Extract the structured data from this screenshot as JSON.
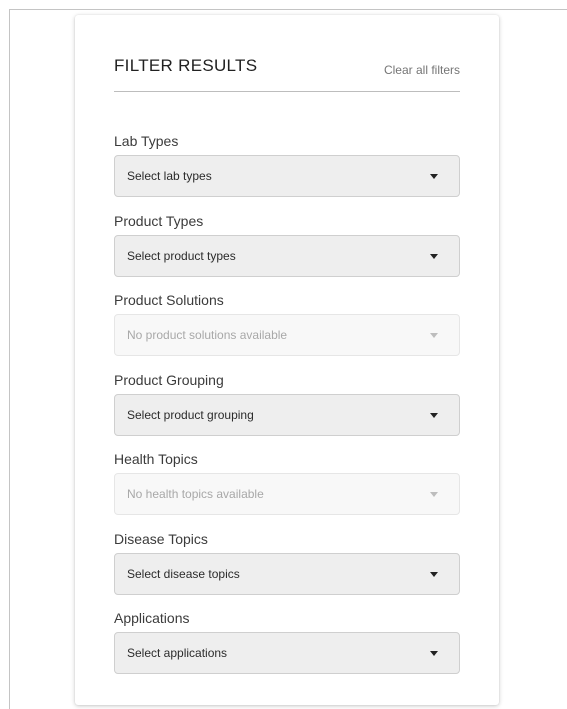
{
  "panel": {
    "title": "FILTER RESULTS",
    "clear_label": "Clear all filters"
  },
  "filters": [
    {
      "label": "Lab Types",
      "value": "Select lab types",
      "disabled": false
    },
    {
      "label": "Product Types",
      "value": "Select product types",
      "disabled": false
    },
    {
      "label": "Product Solutions",
      "value": "No product solutions available",
      "disabled": true
    },
    {
      "label": "Product Grouping",
      "value": "Select product grouping",
      "disabled": false
    },
    {
      "label": "Health Topics",
      "value": "No health topics available",
      "disabled": true
    },
    {
      "label": "Disease Topics",
      "value": "Select disease topics",
      "disabled": false
    },
    {
      "label": "Applications",
      "value": "Select applications",
      "disabled": false
    }
  ],
  "icons": {
    "dropdown": "caret-down-icon"
  }
}
